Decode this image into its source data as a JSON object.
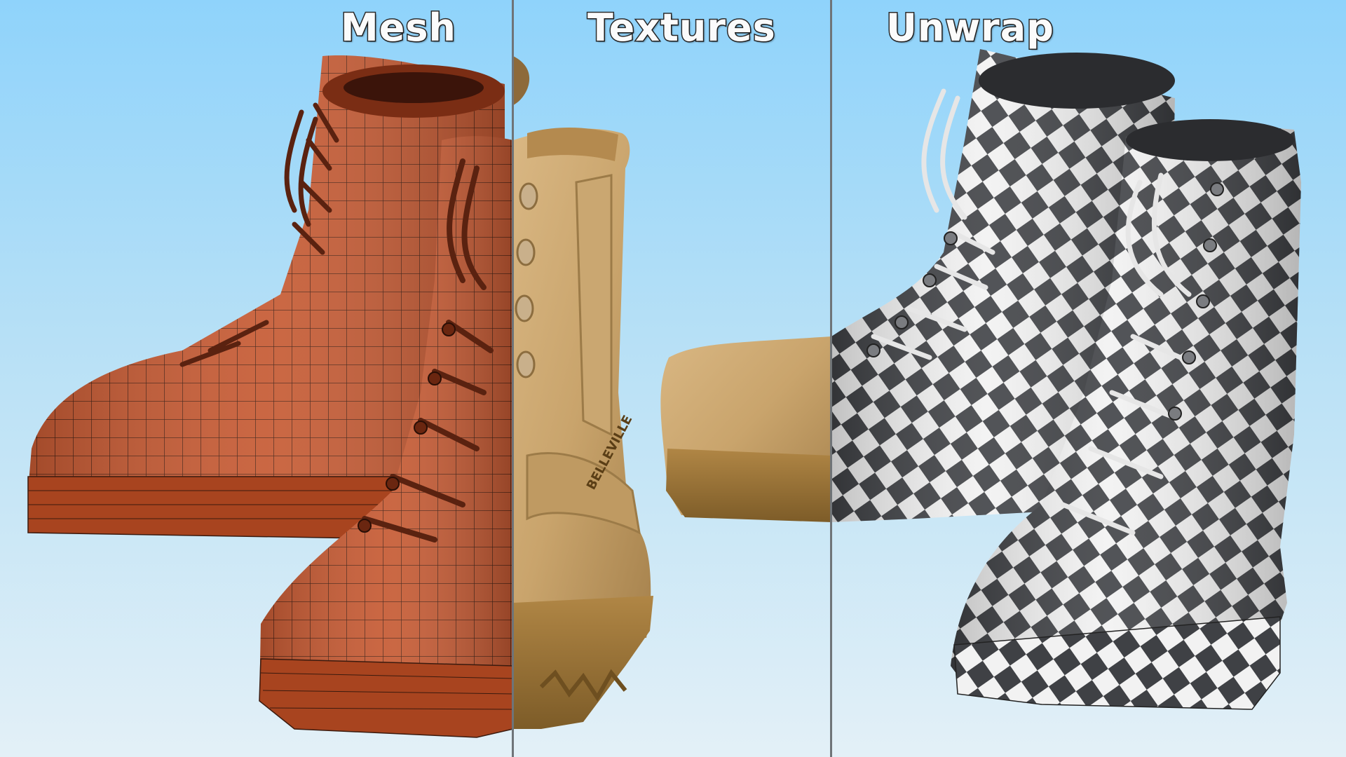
{
  "panels": [
    {
      "title": "Mesh",
      "style": "wireframe",
      "base_color": "#c65a33",
      "wire_color": "#3a1a0e"
    },
    {
      "title": "Textures",
      "style": "textured",
      "base_color": "#c9a46c",
      "sole_color": "#9a7436",
      "brand_text": "BELLEVILLE"
    },
    {
      "title": "Unwrap",
      "style": "checker",
      "checker_dark": "#3f4145",
      "checker_light": "#f2f2f2"
    }
  ],
  "background": {
    "top": "#8fd3fb",
    "bottom": "#e3f0f7"
  },
  "divider_color": "#6f7478"
}
